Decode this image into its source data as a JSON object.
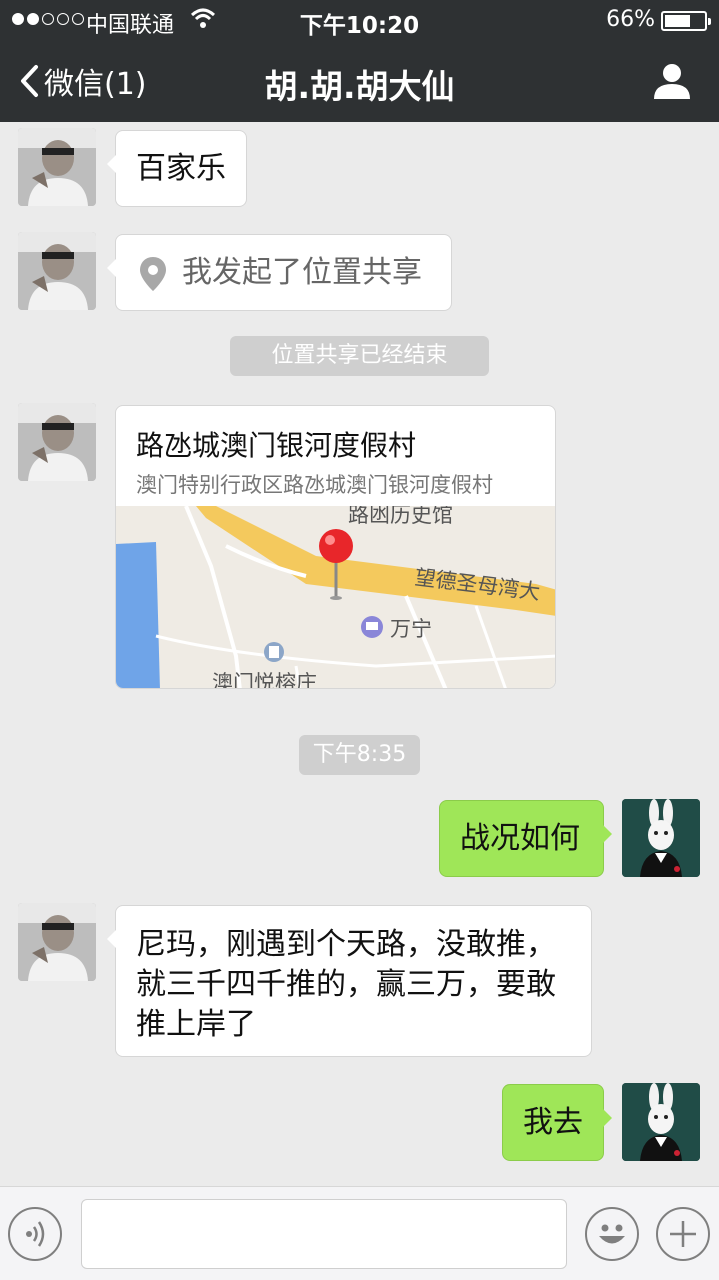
{
  "status_bar": {
    "carrier": "中国联通",
    "time": "下午10:20",
    "battery_percent": "66%",
    "battery_level": 0.66,
    "signal_bars_filled": 2,
    "signal_bars_total": 5
  },
  "nav": {
    "back_label": "微信(1)",
    "title": "胡.胡.胡大仙",
    "profile_icon": "person-icon"
  },
  "messages": [
    {
      "side": "left",
      "text": "百家乐"
    },
    {
      "side": "left",
      "type": "location-share",
      "text": "我发起了位置共享"
    },
    {
      "type": "system",
      "text": "位置共享已经结束"
    },
    {
      "side": "left",
      "type": "location",
      "title": "路氹城澳门银河度假村",
      "address": "澳门特别行政区路氹城澳门银河度假村",
      "map_labels": [
        "路凼历史馆",
        "望德圣母湾大",
        "万宁",
        "澳门悦榕庄"
      ]
    },
    {
      "type": "time",
      "text": "下午8:35"
    },
    {
      "side": "right",
      "text": "战况如何"
    },
    {
      "side": "left",
      "lines": [
        "尼玛，刚遇到个天路，没敢推，",
        "就三千四千推的，赢三万，要敢",
        "推上岸了"
      ]
    },
    {
      "side": "right",
      "text": "我去"
    }
  ],
  "input_bar": {
    "voice_icon": "voice-icon",
    "emoji_icon": "emoji-icon",
    "add_icon": "plus-icon",
    "text_value": ""
  },
  "colors": {
    "header_bg": "#2e3133",
    "chat_bg": "#ebebeb",
    "outgoing_bubble": "#9fe658",
    "incoming_bubble": "#ffffff"
  }
}
